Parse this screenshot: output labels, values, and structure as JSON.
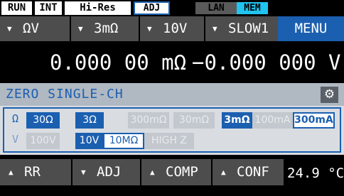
{
  "status_bar": {
    "tags": [
      "RUN",
      "INT",
      "Hi-Res"
    ],
    "adj": "ADJ",
    "lan": "LAN",
    "mem": "MEM"
  },
  "top_row": {
    "function": "ΩV",
    "res_range": "3mΩ",
    "volt_range": "10V",
    "speed": "SLOW1",
    "menu": "MENU"
  },
  "readout": {
    "resistance": "0.000 00 mΩ",
    "voltage": "−0.000 000 V"
  },
  "mode": {
    "label": "ZERO SINGLE-CH",
    "settings_icon": "gear-icon"
  },
  "range_panel": {
    "ohm_label": "Ω",
    "volt_label": "V",
    "ohm_ranges": [
      "30Ω",
      "3Ω",
      "300mΩ",
      "30mΩ",
      "3mΩ"
    ],
    "currents": [
      "100mA",
      "300mA"
    ],
    "volt_ranges": [
      "100V",
      "10V"
    ],
    "impedance": [
      "10MΩ",
      "HIGH Z"
    ]
  },
  "bottom_row": {
    "rr": "RR",
    "adj": "ADJ",
    "comp": "COMP",
    "conf": "CONF"
  },
  "temperature": "24.9 °C",
  "colors": {
    "accent": "#1b5fb0",
    "mem": "#21c4f0",
    "lan": "#5a5a5a"
  }
}
